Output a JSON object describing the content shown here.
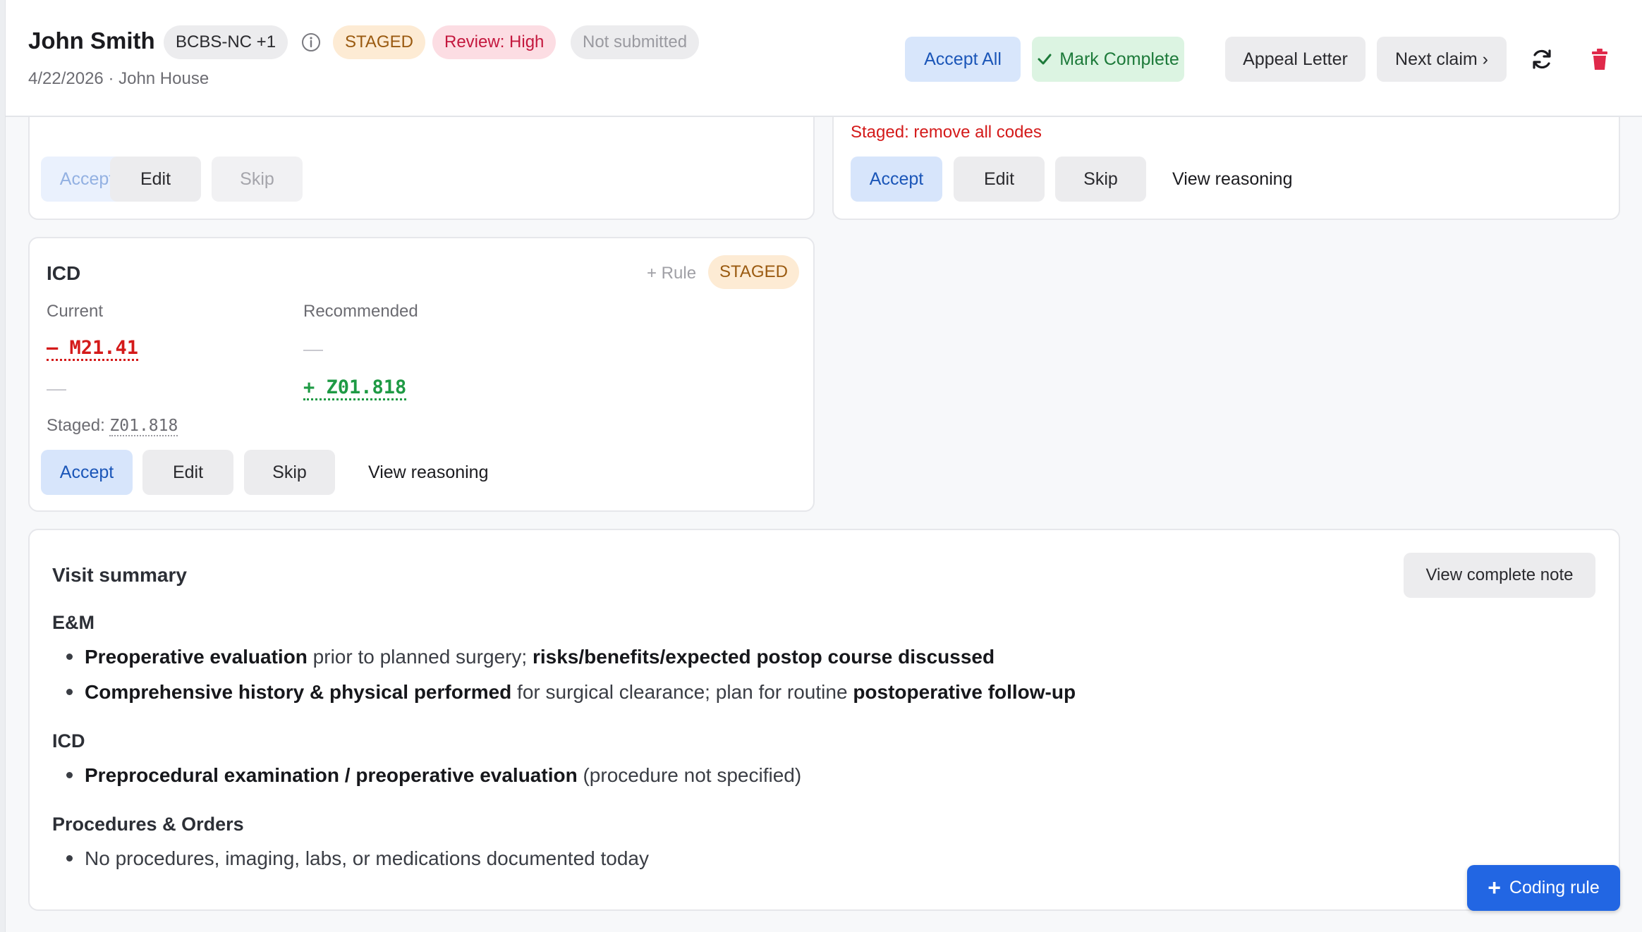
{
  "header": {
    "patient_name": "John Smith",
    "payer": "BCBS-NC +1",
    "status_staged": "STAGED",
    "review": "Review: High",
    "submission": "Not submitted",
    "subline": "4/22/2026 · John House",
    "accept_all": "Accept All",
    "mark_complete": "Mark Complete",
    "appeal_letter": "Appeal Letter",
    "next_claim": "Next claim ›"
  },
  "card_top_left": {
    "current_value": "—",
    "recommended_value": "—",
    "accept": "Accept",
    "edit": "Edit",
    "skip": "Skip"
  },
  "card_top_right": {
    "staged_text": "Staged: remove all codes",
    "accept": "Accept",
    "edit": "Edit",
    "skip": "Skip",
    "view_reasoning": "View reasoning"
  },
  "icd_card": {
    "title": "ICD",
    "rule_link": "+ Rule",
    "status": "STAGED",
    "current_label": "Current",
    "recommended_label": "Recommended",
    "current_codes": [
      "– M21.41",
      "—"
    ],
    "recommended_codes": [
      "—",
      "+ Z01.818"
    ],
    "staged_label": "Staged:",
    "staged_code": "Z01.818",
    "accept": "Accept",
    "edit": "Edit",
    "skip": "Skip",
    "view_reasoning": "View reasoning"
  },
  "visit_summary": {
    "title": "Visit summary",
    "view_note": "View complete note",
    "sections": [
      {
        "heading": "E&M",
        "bullets": [
          [
            {
              "b": "Preoperative evaluation"
            },
            {
              "t": " prior to planned surgery; "
            },
            {
              "b": "risks/benefits/expected postop course discussed"
            }
          ],
          [
            {
              "b": "Comprehensive history & physical performed"
            },
            {
              "t": " for surgical clearance; plan for routine "
            },
            {
              "b": "postoperative follow-up"
            }
          ]
        ]
      },
      {
        "heading": "ICD",
        "bullets": [
          [
            {
              "b": "Preprocedural examination / preoperative evaluation"
            },
            {
              "t": " (procedure not specified)"
            }
          ]
        ]
      },
      {
        "heading": "Procedures & Orders",
        "bullets": [
          [
            {
              "t": "No procedures, imaging, labs, or medications documented today"
            }
          ]
        ]
      }
    ]
  },
  "fab": {
    "label": "Coding rule"
  },
  "colors": {
    "primary": "#2266e3",
    "accept_bg": "#d7e5fb",
    "removed": "#d41a1a",
    "added": "#1e9a44",
    "staged_bg": "#fdebd4",
    "review_bg": "#fcdde3"
  }
}
